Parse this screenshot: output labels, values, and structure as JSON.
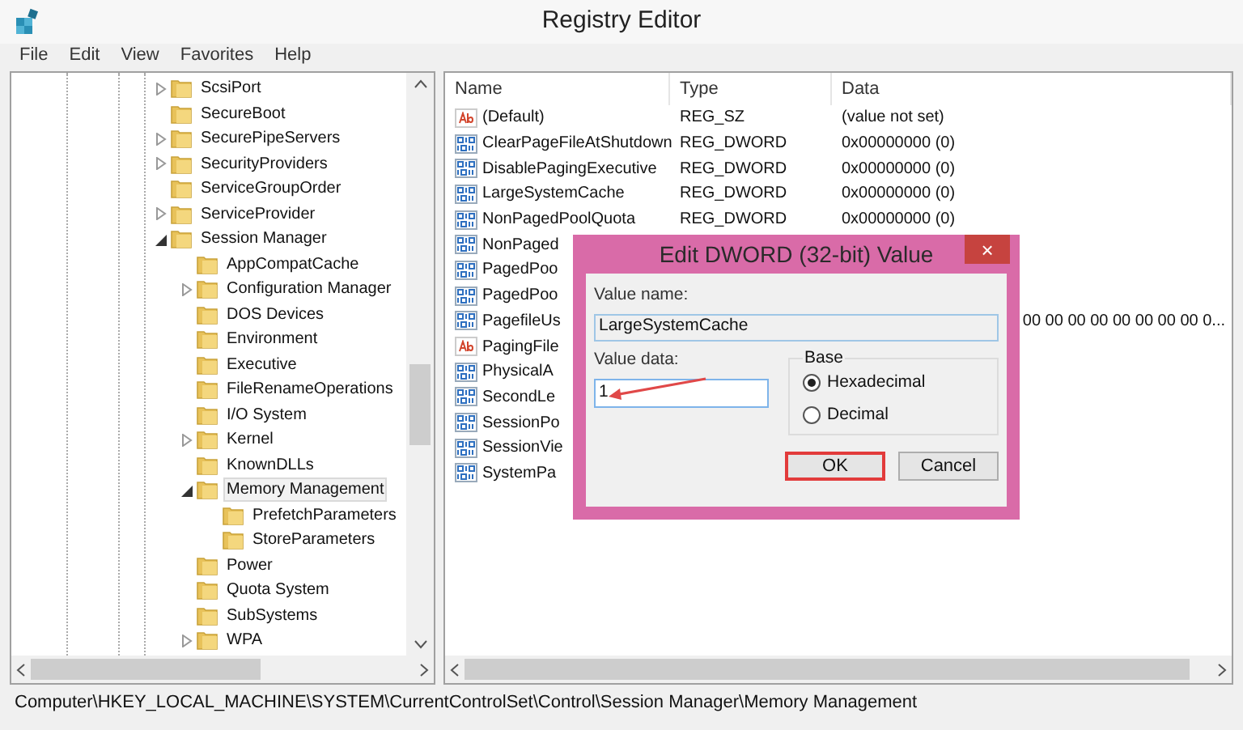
{
  "window": {
    "title": "Registry Editor"
  },
  "menu": [
    "File",
    "Edit",
    "View",
    "Favorites",
    "Help"
  ],
  "tree": [
    {
      "label": "ScsiPort",
      "has_children": true,
      "expanded": false,
      "selected": false
    },
    {
      "label": "SecureBoot",
      "has_children": false,
      "expanded": false,
      "selected": false
    },
    {
      "label": "SecurePipeServers",
      "has_children": true,
      "expanded": false,
      "selected": false
    },
    {
      "label": "SecurityProviders",
      "has_children": true,
      "expanded": false,
      "selected": false
    },
    {
      "label": "ServiceGroupOrder",
      "has_children": false,
      "expanded": false,
      "selected": false
    },
    {
      "label": "ServiceProvider",
      "has_children": true,
      "expanded": false,
      "selected": false
    },
    {
      "label": "Session Manager",
      "has_children": true,
      "expanded": true,
      "selected": false,
      "children": [
        {
          "label": "AppCompatCache",
          "has_children": false,
          "expanded": false,
          "selected": false
        },
        {
          "label": "Configuration Manager",
          "has_children": true,
          "expanded": false,
          "selected": false
        },
        {
          "label": "DOS Devices",
          "has_children": false,
          "expanded": false,
          "selected": false
        },
        {
          "label": "Environment",
          "has_children": false,
          "expanded": false,
          "selected": false
        },
        {
          "label": "Executive",
          "has_children": false,
          "expanded": false,
          "selected": false
        },
        {
          "label": "FileRenameOperations",
          "has_children": false,
          "expanded": false,
          "selected": false
        },
        {
          "label": "I/O System",
          "has_children": false,
          "expanded": false,
          "selected": false
        },
        {
          "label": "Kernel",
          "has_children": true,
          "expanded": false,
          "selected": false
        },
        {
          "label": "KnownDLLs",
          "has_children": false,
          "expanded": false,
          "selected": false
        },
        {
          "label": "Memory Management",
          "has_children": true,
          "expanded": true,
          "selected": true,
          "children": [
            {
              "label": "PrefetchParameters",
              "has_children": false,
              "expanded": false,
              "selected": false
            },
            {
              "label": "StoreParameters",
              "has_children": false,
              "expanded": false,
              "selected": false
            }
          ]
        },
        {
          "label": "Power",
          "has_children": false,
          "expanded": false,
          "selected": false
        },
        {
          "label": "Quota System",
          "has_children": false,
          "expanded": false,
          "selected": false
        },
        {
          "label": "SubSystems",
          "has_children": false,
          "expanded": false,
          "selected": false
        },
        {
          "label": "WPA",
          "has_children": true,
          "expanded": false,
          "selected": false
        }
      ]
    }
  ],
  "table": {
    "columns": [
      "Name",
      "Type",
      "Data"
    ],
    "rows": [
      {
        "kind": "string",
        "name": "(Default)",
        "type": "REG_SZ",
        "data": "(value not set)"
      },
      {
        "kind": "dword",
        "name": "ClearPageFileAtShutdown",
        "type": "REG_DWORD",
        "data": "0x00000000 (0)"
      },
      {
        "kind": "dword",
        "name": "DisablePagingExecutive",
        "type": "REG_DWORD",
        "data": "0x00000000 (0)"
      },
      {
        "kind": "dword",
        "name": "LargeSystemCache",
        "type": "REG_DWORD",
        "data": "0x00000000 (0)"
      },
      {
        "kind": "dword",
        "name": "NonPagedPoolQuota",
        "type": "REG_DWORD",
        "data": "0x00000000 (0)"
      },
      {
        "kind": "dword",
        "name": "NonPaged"
      },
      {
        "kind": "dword",
        "name": "PagedPoo"
      },
      {
        "kind": "dword",
        "name": "PagedPoo"
      },
      {
        "kind": "dword",
        "name": "PagefileUs",
        "data": "00 00 00 00 00 00 00 00 0..."
      },
      {
        "kind": "string",
        "name": "PagingFile"
      },
      {
        "kind": "dword",
        "name": "PhysicalA"
      },
      {
        "kind": "dword",
        "name": "SecondLe"
      },
      {
        "kind": "dword",
        "name": "SessionPo"
      },
      {
        "kind": "dword",
        "name": "SessionVie"
      },
      {
        "kind": "dword",
        "name": "SystemPa"
      }
    ]
  },
  "status_bar": "Computer\\HKEY_LOCAL_MACHINE\\SYSTEM\\CurrentControlSet\\Control\\Session Manager\\Memory Management",
  "dialog": {
    "title": "Edit DWORD (32-bit) Value",
    "close": "×",
    "name_label": "Value name:",
    "name_value": "LargeSystemCache",
    "data_label": "Value data:",
    "data_value": "1",
    "base_label": "Base",
    "radios": [
      {
        "label": "Hexadecimal",
        "selected": true
      },
      {
        "label": "Decimal",
        "selected": false
      }
    ],
    "buttons": [
      {
        "label": "OK",
        "highlighted": true
      },
      {
        "label": "Cancel",
        "highlighted": false
      }
    ]
  }
}
